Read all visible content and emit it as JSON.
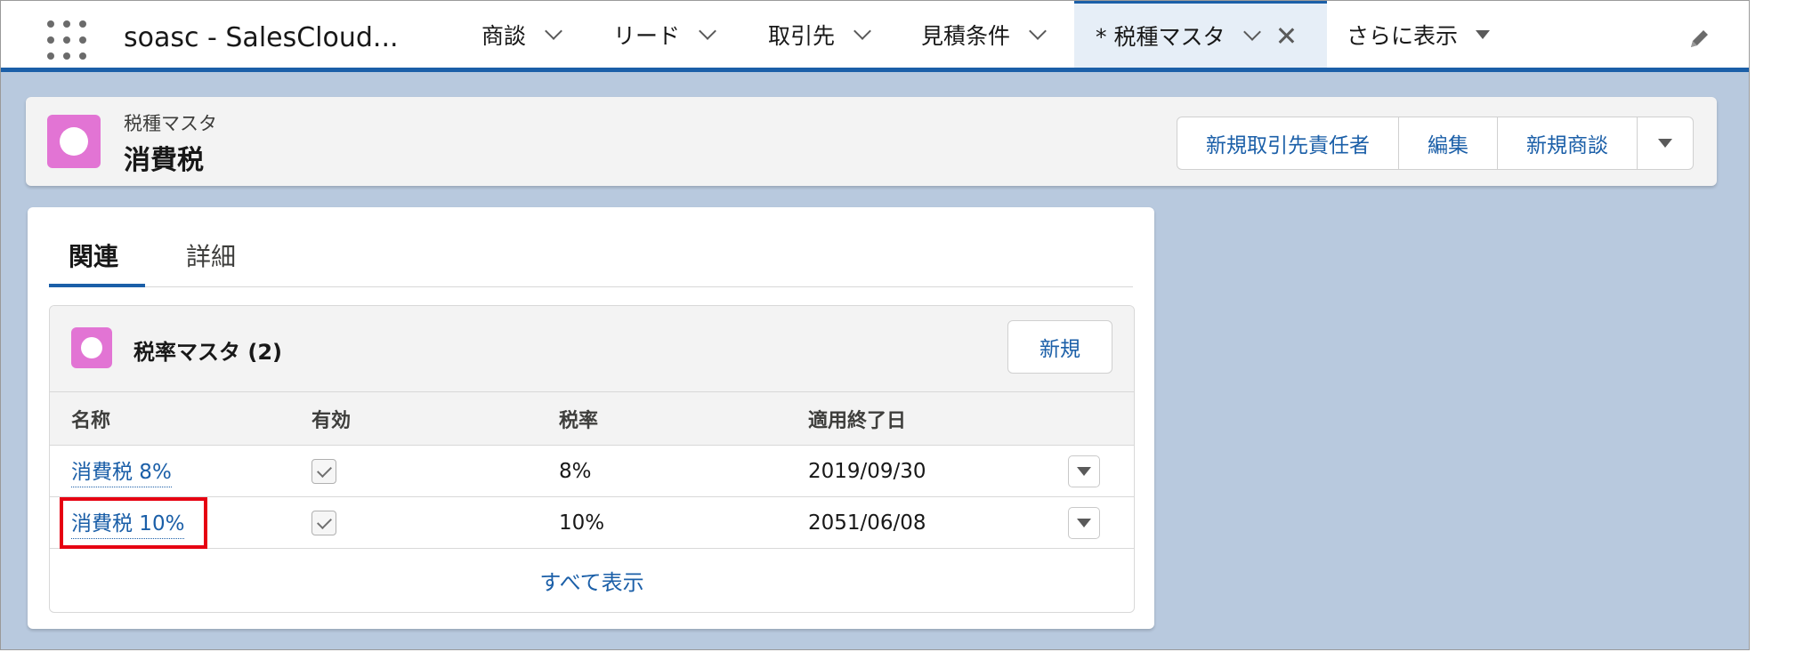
{
  "nav": {
    "app_name": "soasc - SalesCloud...",
    "items": [
      {
        "label": "商談"
      },
      {
        "label": "リード"
      },
      {
        "label": "取引先"
      },
      {
        "label": "見積条件"
      }
    ],
    "active_tab": {
      "label": "* 税種マスタ"
    },
    "more_label": "さらに表示",
    "accent_color": "#1b5fa8"
  },
  "highlights": {
    "object_label": "税種マスタ",
    "record_name": "消費税",
    "icon_color": "#e274d4",
    "actions": [
      "新規取引先責任者",
      "編集",
      "新規商談"
    ]
  },
  "tabs": [
    "関連",
    "詳細"
  ],
  "related_list": {
    "title": "税率マスタ (2)",
    "new_button": "新規",
    "columns": [
      "名称",
      "有効",
      "税率",
      "適用終了日"
    ],
    "rows": [
      {
        "name": "消費税 8%",
        "active": true,
        "rate": "8%",
        "end_date": "2019/09/30"
      },
      {
        "name": "消費税 10%",
        "active": true,
        "rate": "10%",
        "end_date": "2051/06/08"
      }
    ],
    "view_all": "すべて表示"
  },
  "annotation": {
    "highlight_color": "#e60012"
  }
}
